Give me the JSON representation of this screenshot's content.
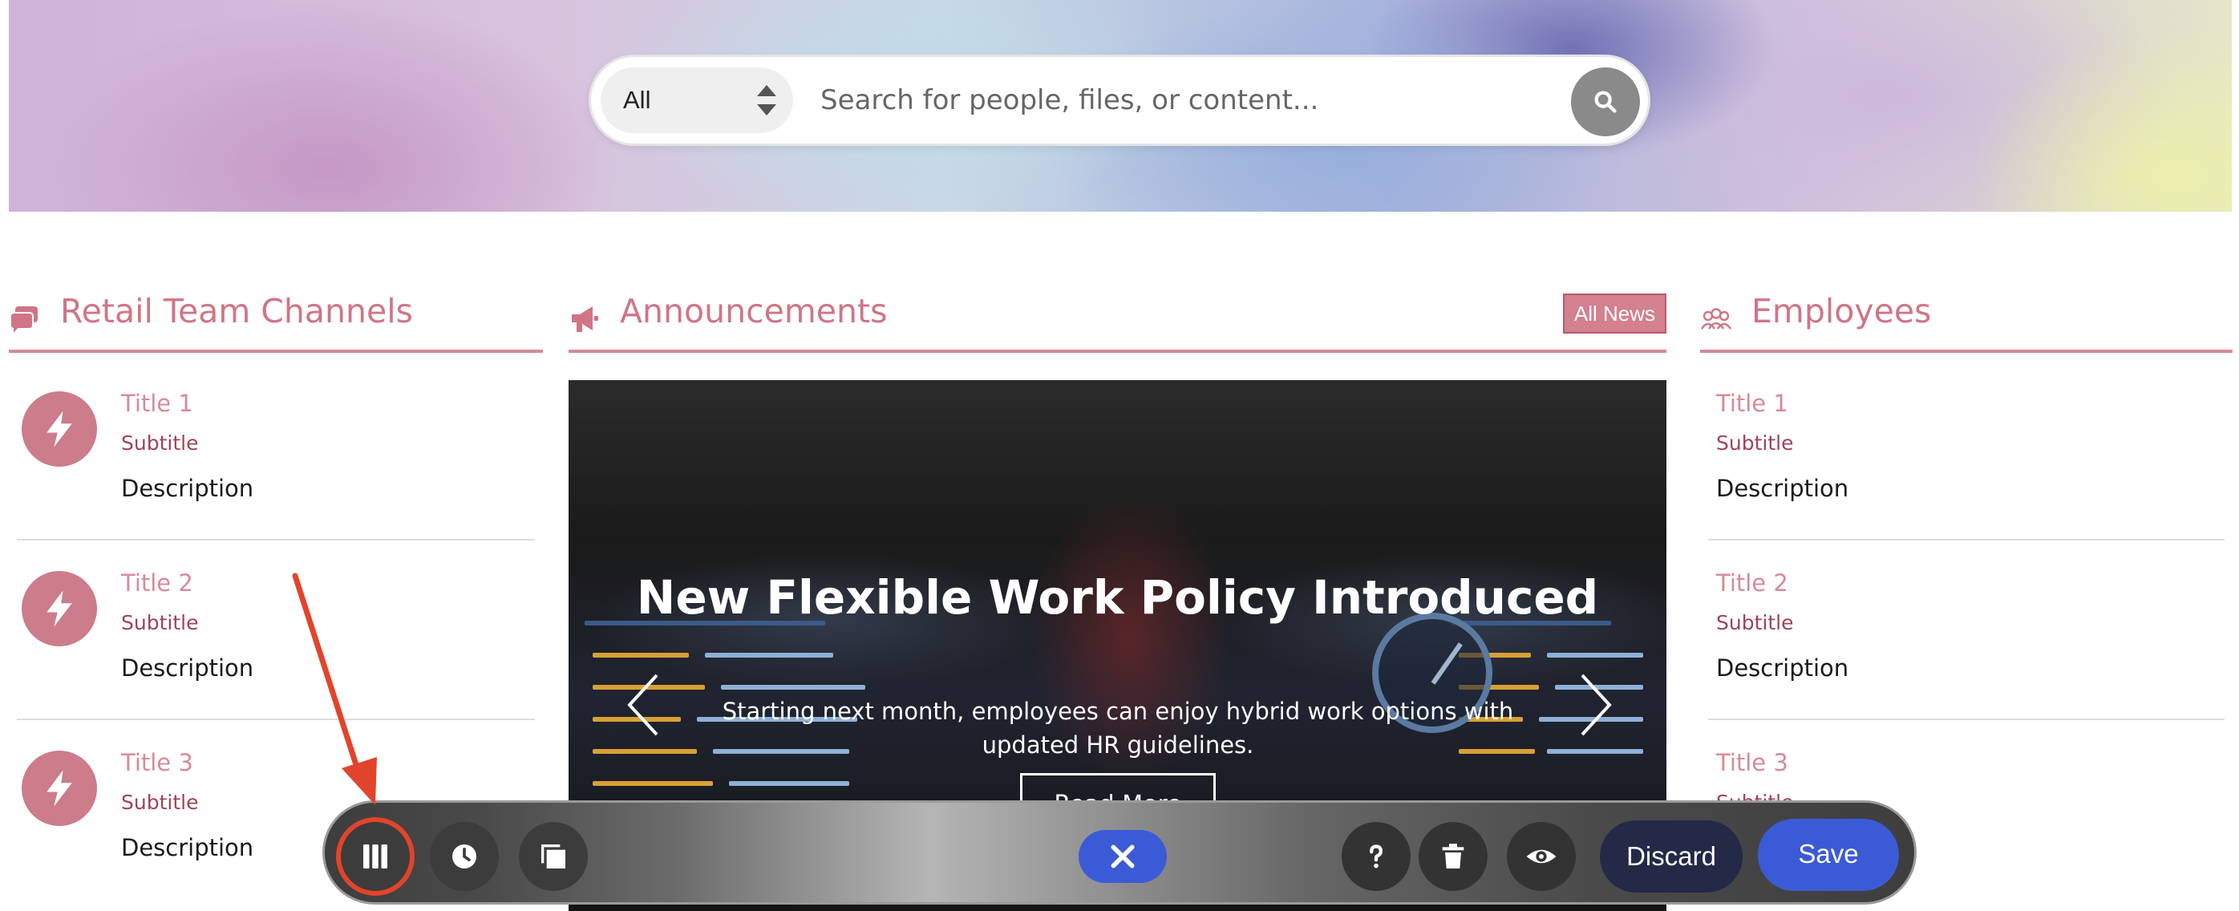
{
  "search": {
    "scope_value": "All",
    "placeholder": "Search for people, files, or content...",
    "search_icon": "search-icon"
  },
  "sections": {
    "channels": {
      "title": "Retail Team Channels",
      "icon": "chat-bubbles-icon",
      "items": [
        {
          "title": "Title 1",
          "subtitle": "Subtitle",
          "description": "Description",
          "icon": "lightning-icon"
        },
        {
          "title": "Title 2",
          "subtitle": "Subtitle",
          "description": "Description",
          "icon": "lightning-icon"
        },
        {
          "title": "Title 3",
          "subtitle": "Subtitle",
          "description": "Description",
          "icon": "lightning-icon"
        }
      ]
    },
    "announcements": {
      "title": "Announcements",
      "icon": "megaphone-icon",
      "all_news_label": "All News",
      "slide": {
        "title": "New Flexible Work Policy Introduced",
        "text": "Starting next month, employees can enjoy hybrid work options with updated HR guidelines.",
        "button_label": "Read More"
      }
    },
    "employees": {
      "title": "Employees",
      "icon": "people-icon",
      "items": [
        {
          "title": "Title 1",
          "subtitle": "Subtitle",
          "description": "Description"
        },
        {
          "title": "Title 2",
          "subtitle": "Subtitle",
          "description": "Description"
        },
        {
          "title": "Title 3",
          "subtitle": "Subtitle"
        }
      ]
    }
  },
  "toolbar": {
    "buttons": [
      "columns-icon",
      "clock-icon",
      "layers-icon",
      "close-icon",
      "help-icon",
      "trash-icon",
      "eye-icon"
    ],
    "discard_label": "Discard",
    "save_label": "Save"
  },
  "colors": {
    "accent_pink": "#d07585",
    "avatar_pink": "#cc7c8a",
    "subtitle_red": "#a04356",
    "save_blue": "#3b5bd6",
    "discard_navy": "#232946",
    "annotation_red": "#e2442b"
  }
}
